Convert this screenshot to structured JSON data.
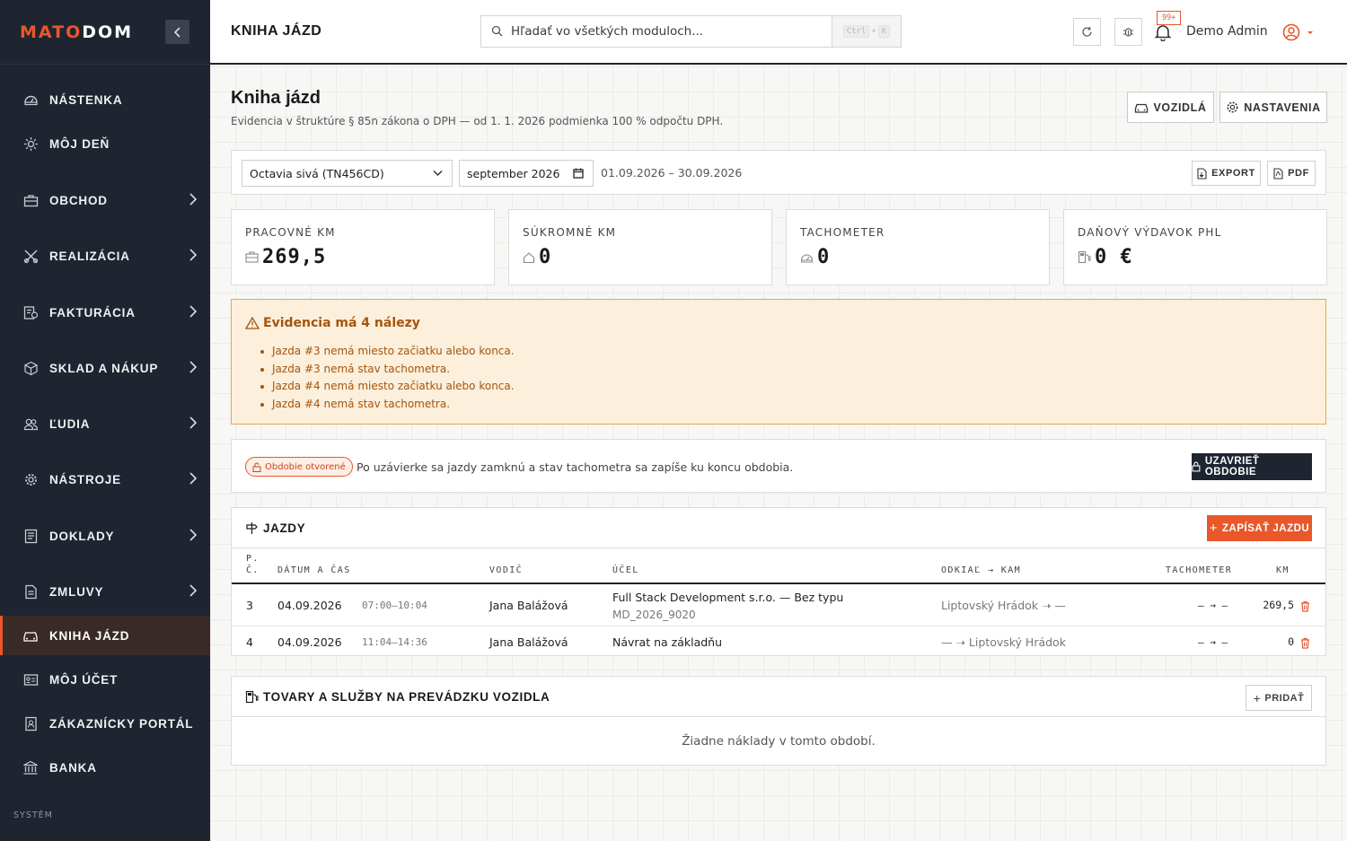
{
  "brand": {
    "part1": "MATO",
    "part2": "DOM"
  },
  "sidebar": {
    "items": [
      {
        "label": "NÁSTENKA"
      },
      {
        "label": "MÔJ DEŇ"
      },
      {
        "label": "OBCHOD"
      },
      {
        "label": "REALIZÁCIA"
      },
      {
        "label": "FAKTURÁCIA"
      },
      {
        "label": "SKLAD A NÁKUP"
      },
      {
        "label": "ĽUDIA"
      },
      {
        "label": "NÁSTROJE"
      },
      {
        "label": "DOKLADY"
      },
      {
        "label": "ZMLUVY"
      },
      {
        "label": "KNIHA JÁZD"
      },
      {
        "label": "MÔJ ÚČET"
      },
      {
        "label": "ZÁKAZNÍCKY PORTÁL"
      },
      {
        "label": "BANKA"
      }
    ],
    "section_system": "SYSTÉM"
  },
  "topbar": {
    "title": "KNIHA JÁZD",
    "search_placeholder": "Hľadať vo všetkých moduloch...",
    "kbd_ctrl": "Ctrl",
    "kbd_plus": "+",
    "kbd_k": "K",
    "notif_badge": "99+",
    "user_name": "Demo Admin"
  },
  "page": {
    "title": "Kniha jázd",
    "subtitle": "Evidencia v štruktúre § 85n zákona o DPH — od 1. 1. 2026 podmienka 100 % odpočtu DPH.",
    "btn_vehicles": "VOZIDLÁ",
    "btn_settings": "NASTAVENIA"
  },
  "filters": {
    "vehicle": "Octavia sivá (TN456CD)",
    "month": "september 2026",
    "range": "01.09.2026 – 30.09.2026",
    "btn_export": "EXPORT",
    "btn_pdf": "PDF"
  },
  "stats": [
    {
      "label": "PRACOVNÉ KM",
      "value": "269,5"
    },
    {
      "label": "SÚKROMNÉ KM",
      "value": "0"
    },
    {
      "label": "TACHOMETER",
      "value": "0"
    },
    {
      "label": "DAŇOVÝ VÝDAVOK PHL",
      "value": "0 €"
    }
  ],
  "alert": {
    "title": "Evidencia má 4 nálezy",
    "items": [
      "Jazda #3 nemá miesto začiatku alebo konca.",
      "Jazda #3 nemá stav tachometra.",
      "Jazda #4 nemá miesto začiatku alebo konca.",
      "Jazda #4 nemá stav tachometra."
    ]
  },
  "period": {
    "badge": "Obdobie otvorené",
    "text": "Po uzávierke sa jazdy zamknú a stav tachometra sa zapíše ku koncu obdobia.",
    "btn_close": "UZAVRIEŤ OBDOBIE"
  },
  "rides": {
    "title": "JAZDY",
    "btn_add": "ZAPÍSAŤ JAZDU",
    "columns": {
      "no_line1": "P.",
      "no_line2": "Č.",
      "datetime": "DÁTUM A ČAS",
      "driver": "VODIČ",
      "purpose": "ÚČEL",
      "route": "ODKIAĽ → KAM",
      "odometer": "TACHOMETER",
      "km": "KM"
    },
    "rows": [
      {
        "no": "3",
        "date": "04.09.2026",
        "time": "07:00–10:04",
        "driver": "Jana Balážová",
        "purpose": "Full Stack Development s.r.o. — Bez typu",
        "purpose_sub": "MD_2026_9020",
        "route": "Liptovský Hrádok ➝ —",
        "odometer": "— → —",
        "km": "269,5"
      },
      {
        "no": "4",
        "date": "04.09.2026",
        "time": "11:04–14:36",
        "driver": "Jana Balážová",
        "purpose": "Návrat na základňu",
        "purpose_sub": "",
        "route": "— ➝ Liptovský Hrádok",
        "odometer": "— → —",
        "km": "0"
      }
    ]
  },
  "goods": {
    "title": "TOVARY A SLUŽBY NA PREVÁDZKU VOZIDLA",
    "btn_add": "PRIDAŤ",
    "empty": "Žiadne náklady v tomto období."
  },
  "colors": {
    "accent": "#e9572b",
    "sidebar_bg": "#1e2530",
    "warning_bg": "#fcefdb",
    "warning_text": "#a4550f"
  }
}
